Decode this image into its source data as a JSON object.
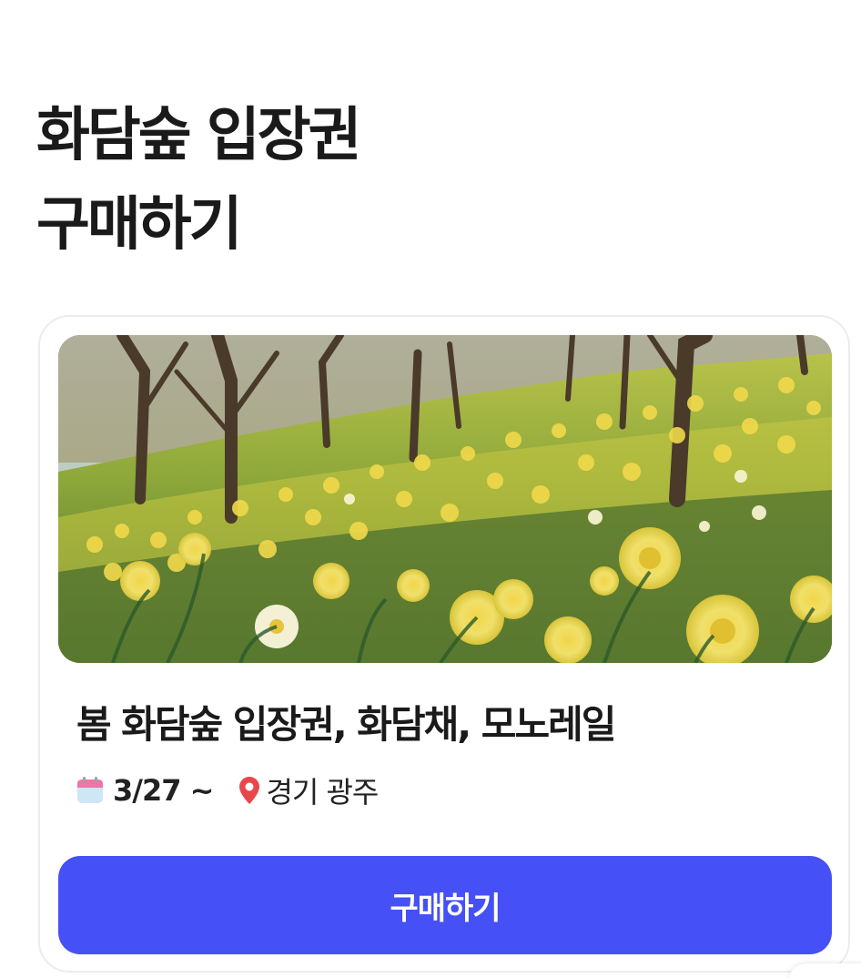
{
  "page": {
    "title_line1": "화담숲 입장권",
    "title_line2": "구매하기"
  },
  "card": {
    "image_description_icon": "daffodil-field-photo",
    "event_title": "봄 화담숲 입장권, 화담채, 모노레일",
    "date_icon": "calendar-icon",
    "date_text": "3/27 ~",
    "location_icon": "map-pin-icon",
    "location_text": "경기 광주",
    "buy_label": "구매하기"
  },
  "colors": {
    "accent": "#4551f6",
    "pin": "#e8474c",
    "calendar_top": "#f472a6",
    "calendar_body": "#cfe6f5"
  }
}
